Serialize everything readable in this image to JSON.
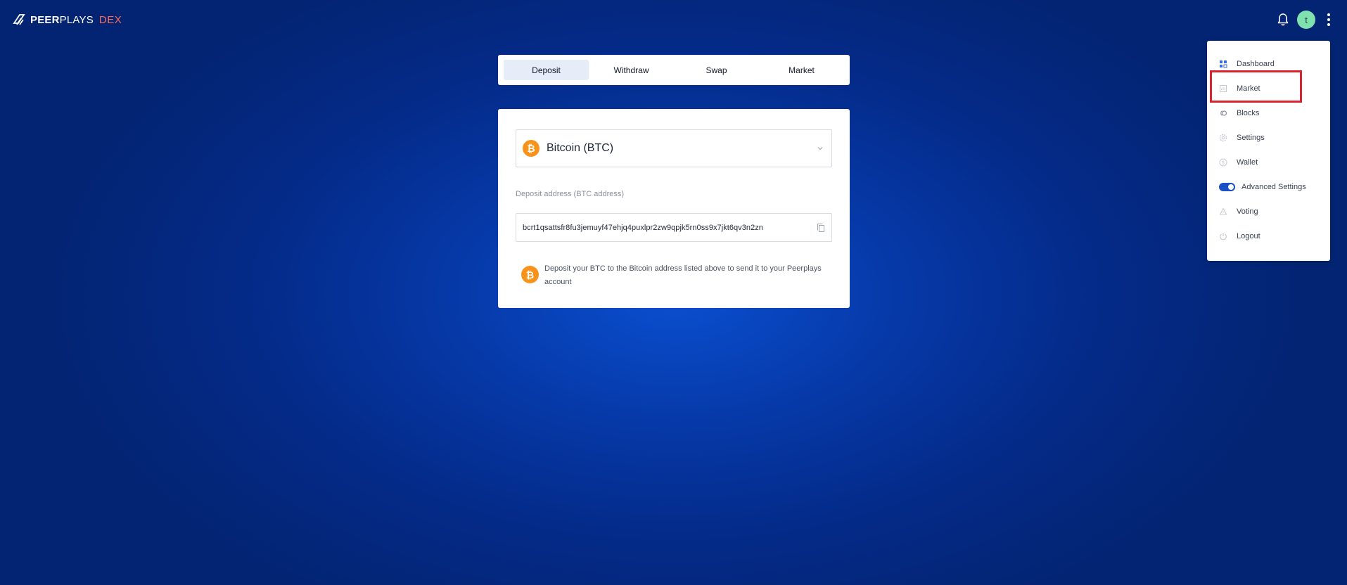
{
  "brand": {
    "name_bold": "PEER",
    "name_regular": "PLAYS",
    "product": "DEX"
  },
  "header": {
    "avatar_initial": "t"
  },
  "tabs": [
    {
      "label": "Deposit",
      "active": true
    },
    {
      "label": "Withdraw",
      "active": false
    },
    {
      "label": "Swap",
      "active": false
    },
    {
      "label": "Market",
      "active": false
    }
  ],
  "deposit": {
    "asset_symbol": "₿",
    "asset_label": "Bitcoin (BTC)",
    "address_label": "Deposit address (BTC address)",
    "address_value": "bcrt1qsattsfr8fu3jemuyf47ehjq4puxlpr2zw9qpjk5rn0ss9x7jkt6qv3n2zn",
    "info_text": "Deposit your BTC to the Bitcoin address listed above to send it to your Peerplays account"
  },
  "menu": {
    "items": [
      {
        "label": "Dashboard",
        "icon": "dashboard-icon"
      },
      {
        "label": "Market",
        "icon": "market-icon",
        "highlighted": true
      },
      {
        "label": "Blocks",
        "icon": "blocks-icon"
      },
      {
        "label": "Settings",
        "icon": "settings-icon"
      },
      {
        "label": "Wallet",
        "icon": "wallet-icon"
      },
      {
        "label": "Advanced Settings",
        "icon": "toggle-switch",
        "toggle_on": true
      },
      {
        "label": "Voting",
        "icon": "voting-icon"
      },
      {
        "label": "Logout",
        "icon": "logout-icon"
      }
    ]
  },
  "colors": {
    "background": "#0639a8",
    "accent": "#1b4fc4",
    "bitcoin": "#f7931a",
    "dex": "#ff6b5b",
    "highlight": "#d9232e",
    "avatar": "#7fe0b0"
  }
}
